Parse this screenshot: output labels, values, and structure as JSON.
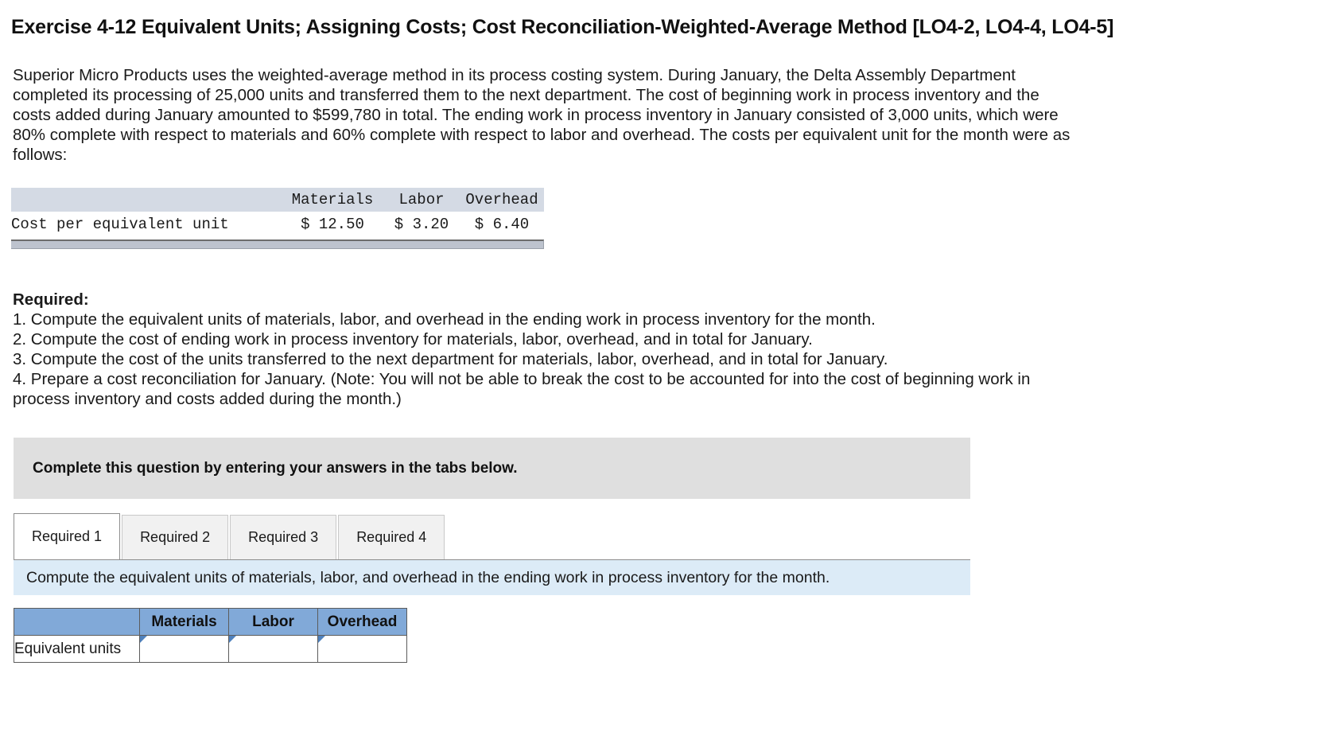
{
  "title": "Exercise 4-12 Equivalent Units; Assigning Costs; Cost Reconciliation-Weighted-Average Method [LO4-2, LO4-4, LO4-5]",
  "intro": "Superior Micro Products uses the weighted-average method in its process costing system. During January, the Delta Assembly Department completed its processing of 25,000 units and transferred them to the next department. The cost of beginning work in process inventory and the costs added during January amounted to $599,780 in total. The ending work in process inventory in January consisted of 3,000 units, which were 80% complete with respect to materials and 60% complete with respect to labor and overhead. The costs per equivalent unit for the month were as follows:",
  "cost_table": {
    "headers": [
      "",
      "Materials",
      "Labor",
      "Overhead"
    ],
    "rows": [
      {
        "label": "Cost per equivalent unit",
        "materials": "$ 12.50",
        "labor": "$ 3.20",
        "overhead": "$ 6.40"
      }
    ]
  },
  "required": {
    "heading": "Required:",
    "items": [
      "1. Compute the equivalent units of materials, labor, and overhead in the ending work in process inventory for the month.",
      "2. Compute the cost of ending work in process inventory for materials, labor, overhead, and in total for January.",
      "3. Compute the cost of the units transferred to the next department for materials, labor, overhead, and in total for January.",
      "4. Prepare a cost reconciliation for January. (Note: You will not be able to break the cost to be accounted for into the cost of beginning work in process inventory and costs added during the month.)"
    ]
  },
  "complete_box": {
    "text": "Complete this question by entering your answers in the tabs below."
  },
  "tabs": [
    {
      "label": "Required 1",
      "active": true
    },
    {
      "label": "Required 2",
      "active": false
    },
    {
      "label": "Required 3",
      "active": false
    },
    {
      "label": "Required 4",
      "active": false
    }
  ],
  "instruction": "Compute the equivalent units of materials, labor, and overhead in the ending work in process inventory for the month.",
  "answer_table": {
    "headers": [
      "",
      "Materials",
      "Labor",
      "Overhead"
    ],
    "rows": [
      {
        "label": "Equivalent units",
        "materials": "",
        "labor": "",
        "overhead": ""
      }
    ]
  },
  "colors": {
    "accent_blue": "#81a9d8",
    "instruction_bg": "#dcebf7",
    "complete_bg": "#dfdfdf",
    "mono_header_bg": "#d4dae4",
    "marker_blue": "#4f81bd"
  }
}
